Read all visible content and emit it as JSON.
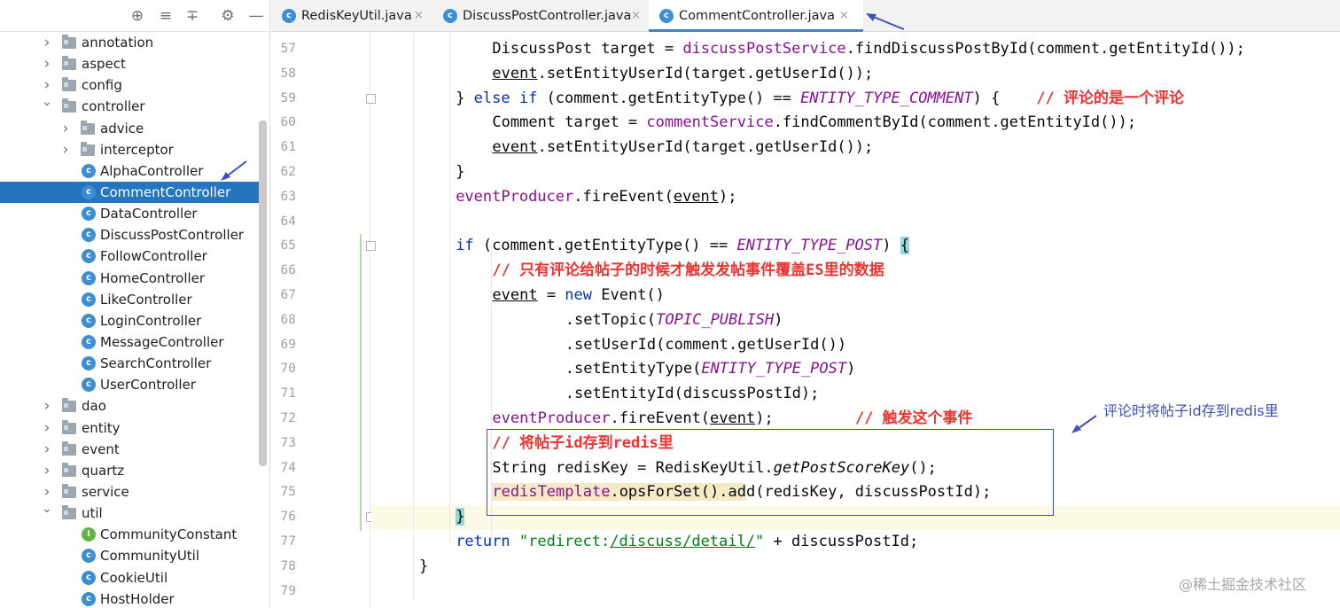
{
  "sidebar": {
    "toolbar": {
      "locate_icon": "⊕",
      "expand_icon": "≡",
      "collapse_icon": "∓",
      "settings_icon": "⚙",
      "hide_icon": "—"
    },
    "tree": [
      {
        "label": "annotation",
        "kind": "folder",
        "expanded": false
      },
      {
        "label": "aspect",
        "kind": "folder",
        "expanded": false
      },
      {
        "label": "config",
        "kind": "folder",
        "expanded": false
      },
      {
        "label": "controller",
        "kind": "folder",
        "expanded": true
      },
      {
        "label": "advice",
        "kind": "folder",
        "expanded": false
      },
      {
        "label": "interceptor",
        "kind": "folder",
        "expanded": false
      },
      {
        "label": "AlphaController",
        "kind": "class"
      },
      {
        "label": "CommentController",
        "kind": "class",
        "selected": true
      },
      {
        "label": "DataController",
        "kind": "class"
      },
      {
        "label": "DiscussPostController",
        "kind": "class"
      },
      {
        "label": "FollowController",
        "kind": "class"
      },
      {
        "label": "HomeController",
        "kind": "class"
      },
      {
        "label": "LikeController",
        "kind": "class"
      },
      {
        "label": "LoginController",
        "kind": "class"
      },
      {
        "label": "MessageController",
        "kind": "class"
      },
      {
        "label": "SearchController",
        "kind": "class"
      },
      {
        "label": "UserController",
        "kind": "class"
      },
      {
        "label": "dao",
        "kind": "folder",
        "expanded": false
      },
      {
        "label": "entity",
        "kind": "folder",
        "expanded": false
      },
      {
        "label": "event",
        "kind": "folder",
        "expanded": false
      },
      {
        "label": "quartz",
        "kind": "folder",
        "expanded": false
      },
      {
        "label": "service",
        "kind": "folder",
        "expanded": false
      },
      {
        "label": "util",
        "kind": "folder",
        "expanded": true
      },
      {
        "label": "CommunityConstant",
        "kind": "interface"
      },
      {
        "label": "CommunityUtil",
        "kind": "class"
      },
      {
        "label": "CookieUtil",
        "kind": "class"
      },
      {
        "label": "HostHolder",
        "kind": "class"
      }
    ]
  },
  "tabs": [
    {
      "label": "RedisKeyUtil.java",
      "active": false
    },
    {
      "label": "DiscussPostController.java",
      "active": false
    },
    {
      "label": "CommentController.java",
      "active": true
    }
  ],
  "tab_close_glyph": "×",
  "class_icon_letter": "c",
  "interface_icon_letter": "I",
  "editor": {
    "line_numbers": [
      "57",
      "58",
      "59",
      "60",
      "61",
      "62",
      "63",
      "64",
      "65",
      "66",
      "67",
      "68",
      "69",
      "70",
      "71",
      "72",
      "73",
      "74",
      "75",
      "76",
      "77",
      "78",
      "79"
    ],
    "current_line": "76",
    "code": {
      "l57": [
        "DiscussPost target = ",
        "discussPostService",
        ".findDiscussPostById(comment.getEntityId());"
      ],
      "l58": [
        "event",
        ".setEntityUserId(target.getUserId());"
      ],
      "l59": [
        "} ",
        "else if",
        " (comment.getEntityType() == ",
        "ENTITY_TYPE_COMMENT",
        ") {",
        "// 评论的是一个评论"
      ],
      "l60": [
        "Comment target = ",
        "commentService",
        ".findCommentById(comment.getEntityId());"
      ],
      "l61": [
        "event",
        ".setEntityUserId(target.getUserId());"
      ],
      "l62": [
        "}"
      ],
      "l63": [
        "eventProducer",
        ".fireEvent(",
        "event",
        ");"
      ],
      "l65": [
        "if",
        " (comment.getEntityType() == ",
        "ENTITY_TYPE_POST",
        ") ",
        "{"
      ],
      "l66": [
        "// 只有评论给帖子的时候才触发发帖事件覆盖ES里的数据"
      ],
      "l67": [
        "event",
        " = ",
        "new",
        " Event()"
      ],
      "l68": [
        ".setTopic(",
        "TOPIC_PUBLISH",
        ")"
      ],
      "l69": [
        ".setUserId(comment.getUserId())"
      ],
      "l70": [
        ".setEntityType(",
        "ENTITY_TYPE_POST",
        ")"
      ],
      "l71": [
        ".setEntityId(discussPostId);"
      ],
      "l72": [
        "eventProducer",
        ".fireEvent(",
        "event",
        ");",
        "// 触发这个事件"
      ],
      "l73": [
        "// 将帖子id存到redis里"
      ],
      "l74": [
        "String redisKey = RedisKeyUtil.",
        "getPostScoreKey",
        "();"
      ],
      "l75": [
        "redisTemplate",
        ".opsForSet().add(redisKey, discussPostId);"
      ],
      "l76": [
        "}"
      ],
      "l77": [
        "return",
        " ",
        "\"redirect:",
        "/discuss/detail/",
        "\"",
        " + discussPostId;"
      ],
      "l78": [
        "}"
      ]
    }
  },
  "annotation": {
    "note": "评论时将帖子id存到redis里"
  },
  "watermark": "@稀土掘金技术社区",
  "colors": {
    "keyword": "#0033b3",
    "field": "#871094",
    "string": "#067d17",
    "comment_annotation": "#ee3333",
    "selection": "#2675bf",
    "annotation_blue": "#3f51b5"
  }
}
